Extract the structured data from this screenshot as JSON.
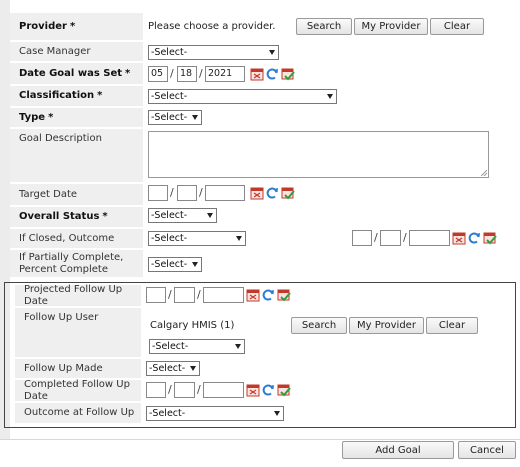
{
  "provider": {
    "label": "Provider",
    "req": "*",
    "text": "Please choose a provider.",
    "search": "Search",
    "my_provider": "My Provider",
    "clear": "Clear"
  },
  "case_manager": {
    "label": "Case Manager",
    "value": "-Select-"
  },
  "date_goal": {
    "label": "Date Goal was Set",
    "req": "*",
    "month": "05",
    "day": "18",
    "year": "2021"
  },
  "classification": {
    "label": "Classification",
    "req": "*",
    "value": "-Select-"
  },
  "type": {
    "label": "Type",
    "req": "*",
    "value": "-Select-"
  },
  "goal_description": {
    "label": "Goal Description"
  },
  "target_date": {
    "label": "Target Date"
  },
  "overall_status": {
    "label": "Overall Status",
    "req": "*",
    "value": "-Select-"
  },
  "if_closed": {
    "label": "If Closed, Outcome",
    "value": "-Select-"
  },
  "partial": {
    "label": "If Partially Complete, Percent Complete",
    "value": "-Select-"
  },
  "followup": {
    "projected_label": "Projected Follow Up Date",
    "user_label": "Follow Up User",
    "user_text": "Calgary HMIS (1)",
    "user_value": "-Select-",
    "search": "Search",
    "my_provider": "My Provider",
    "clear": "Clear",
    "made_label": "Follow Up Made",
    "made_value": "-Select-",
    "completed_label": "Completed Follow Up Date",
    "outcome_label": "Outcome at Follow Up",
    "outcome_value": "-Select-"
  },
  "footer": {
    "add_goal": "Add Goal",
    "cancel": "Cancel"
  },
  "icons": [
    "calendar-icon",
    "refresh-icon",
    "calendar-check-icon"
  ],
  "colors": {
    "label_bg": "#efefef",
    "calendar_red": "#c0392b",
    "refresh_blue": "#2b7cd3",
    "check_green": "#2e9e3f"
  }
}
